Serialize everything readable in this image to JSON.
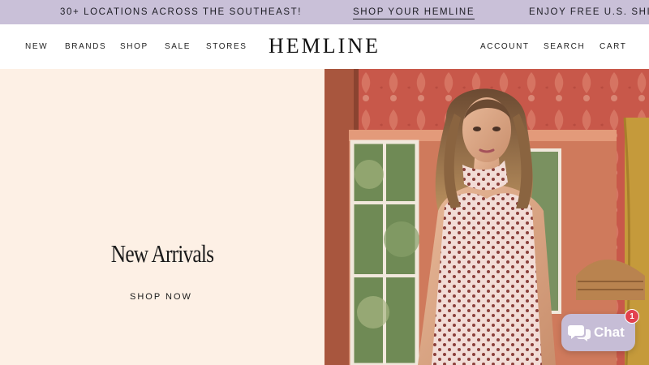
{
  "announcement": {
    "items": [
      "30+ LOCATIONS ACROSS THE SOUTHEAST!",
      "SHOP YOUR HEMLINE",
      "ENJOY FREE U.S. SHIPPING"
    ]
  },
  "header": {
    "logo": "HEMLINE",
    "nav_left": [
      "NEW",
      "BRANDS",
      "SHOP",
      "SALE",
      "STORES"
    ],
    "nav_right": [
      "ACCOUNT",
      "SEARCH",
      "CART"
    ]
  },
  "hero": {
    "title": "New Arrivals",
    "cta": "SHOP NOW"
  },
  "chat": {
    "label": "Chat",
    "badge": "1",
    "icon": "chat-bubbles-icon"
  },
  "colors": {
    "announcement_bg": "#c9c0d8",
    "hero_left_bg": "#fdf0e5",
    "chat_bg": "#c6bdd6",
    "badge_bg": "#e2424f"
  }
}
